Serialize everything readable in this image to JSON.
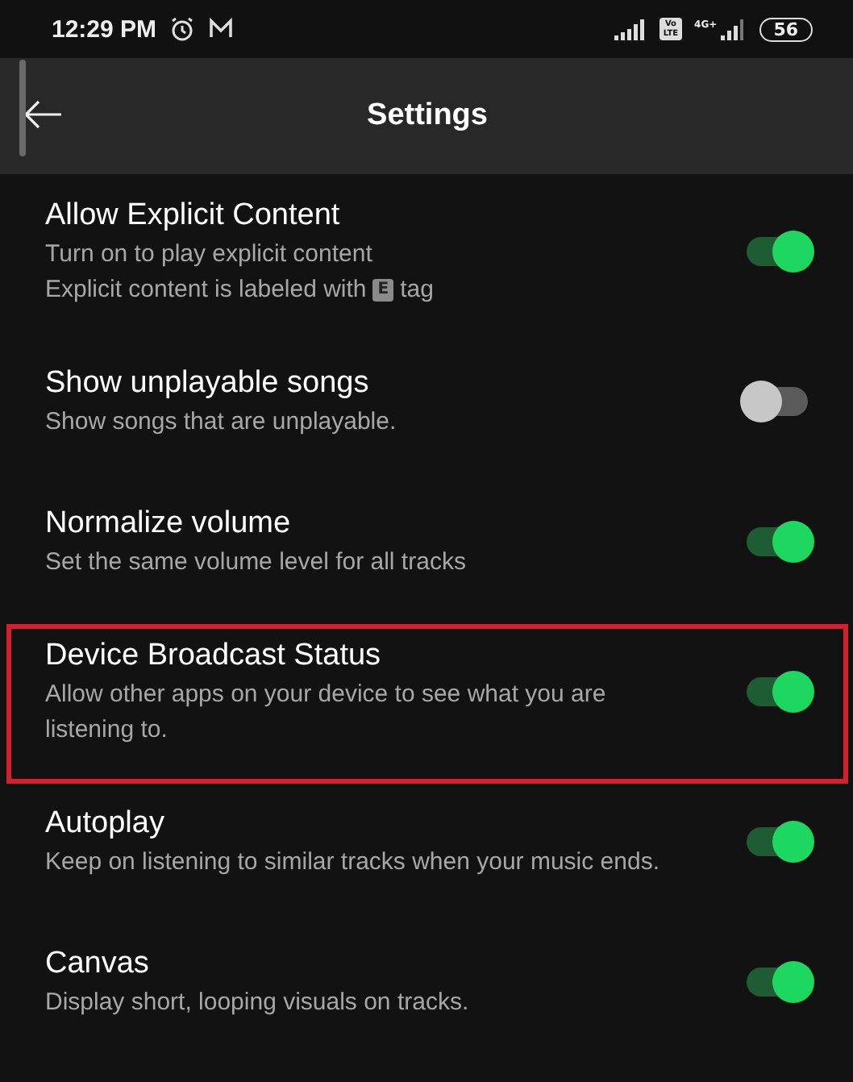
{
  "status_bar": {
    "time": "12:29 PM",
    "volte": [
      "Vo",
      "LTE"
    ],
    "network": "4G+",
    "battery": "56"
  },
  "header": {
    "title": "Settings"
  },
  "settings": [
    {
      "title": "Allow Explicit Content",
      "on": true,
      "highlighted": false,
      "description": [
        {
          "text": "Turn on to play explicit content"
        },
        {
          "text": "Explicit content is labeled with",
          "badge": "E",
          "after": "tag"
        }
      ]
    },
    {
      "title": "Show unplayable songs",
      "on": false,
      "highlighted": false,
      "description": [
        {
          "text": "Show songs that are unplayable."
        }
      ]
    },
    {
      "title": "Normalize volume",
      "on": true,
      "highlighted": false,
      "description": [
        {
          "text": "Set the same volume level for all tracks"
        }
      ]
    },
    {
      "title": "Device Broadcast Status",
      "on": true,
      "highlighted": true,
      "description": [
        {
          "text": "Allow other apps on your device to see what you are listening to."
        }
      ]
    },
    {
      "title": "Autoplay",
      "on": true,
      "highlighted": false,
      "description": [
        {
          "text": "Keep on listening to similar tracks when your music ends."
        }
      ]
    },
    {
      "title": "Canvas",
      "on": true,
      "highlighted": false,
      "description": [
        {
          "text": "Display short, looping visuals on tracks."
        }
      ]
    }
  ]
}
